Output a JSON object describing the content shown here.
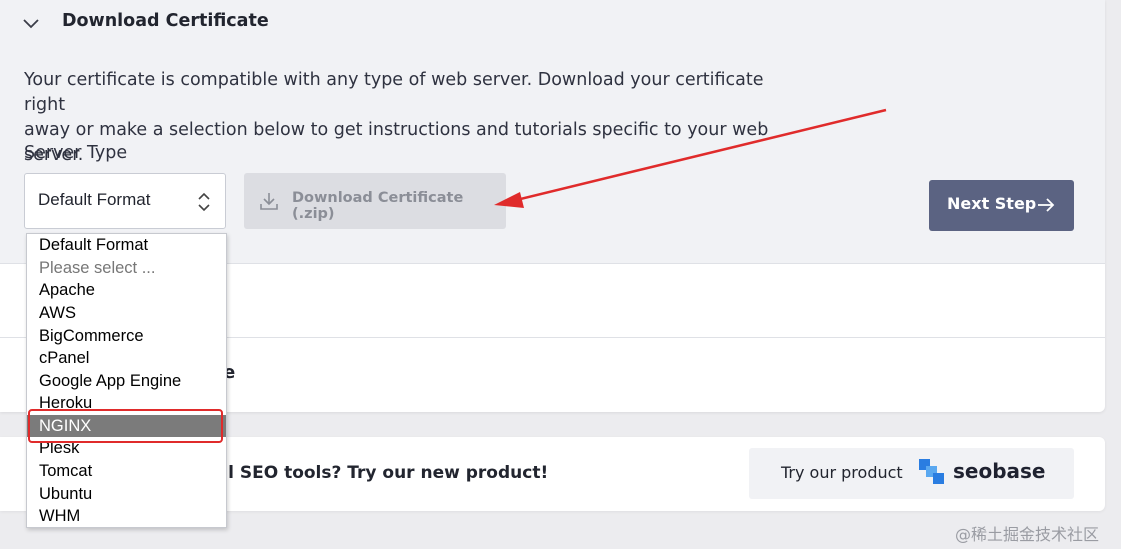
{
  "section": {
    "title": "Download Certificate",
    "description_line1": "Your certificate is compatible with any type of web server. Download your certificate right",
    "description_line2": "away or make a selection below to get instructions and tutorials specific to your web server."
  },
  "server_type": {
    "label": "Server Type",
    "selected": "Default Format",
    "options": [
      {
        "label": "Default Format",
        "state": "normal"
      },
      {
        "label": "Please select ...",
        "state": "placeholder"
      },
      {
        "label": "Apache",
        "state": "normal"
      },
      {
        "label": "AWS",
        "state": "normal"
      },
      {
        "label": "BigCommerce",
        "state": "normal"
      },
      {
        "label": "cPanel",
        "state": "normal"
      },
      {
        "label": "Google App Engine",
        "state": "normal"
      },
      {
        "label": "Heroku",
        "state": "normal"
      },
      {
        "label": "NGINX",
        "state": "highlighted"
      },
      {
        "label": "Plesk",
        "state": "normal"
      },
      {
        "label": "Tomcat",
        "state": "normal"
      },
      {
        "label": "Ubuntu",
        "state": "normal"
      },
      {
        "label": "WHM",
        "state": "normal"
      }
    ]
  },
  "buttons": {
    "download": "Download Certificate (.zip)",
    "next": "Next Step"
  },
  "hidden_row_text": "te",
  "promo": {
    "text": "ul SEO tools? Try our new product!",
    "button": "Try our product",
    "brand": "seobase"
  },
  "watermark": "@稀土掘金技术社区",
  "icons": {
    "chevron": "chevron-down-icon",
    "select": "select-arrows-icon",
    "download": "download-icon",
    "next": "arrow-right-icon",
    "brand": "seobase-logo-icon"
  },
  "colors": {
    "primary_button": "#5b6382",
    "disabled_button": "#dcdde2",
    "annotation": "#e02b2b",
    "selected_option": "#7b7b7b",
    "brand_blue": "#2a7de1"
  }
}
